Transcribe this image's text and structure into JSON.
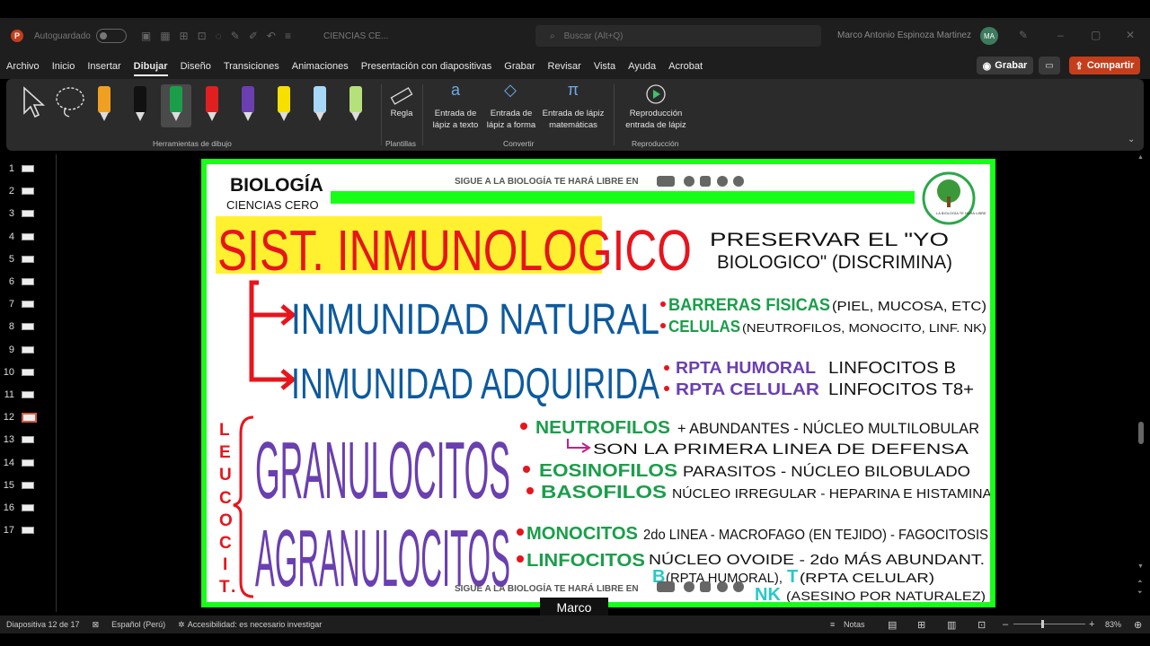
{
  "app": {
    "autosave_label": "Autoguardado",
    "document_title": "CIENCIAS CE...",
    "search_placeholder": "Buscar (Alt+Q)",
    "user_name": "Marco Antonio Espinoza Martinez",
    "user_initials": "MA"
  },
  "menu": {
    "items": [
      "Archivo",
      "Inicio",
      "Insertar",
      "Dibujar",
      "Diseño",
      "Transiciones",
      "Animaciones",
      "Presentación con diapositivas",
      "Grabar",
      "Revisar",
      "Vista",
      "Ayuda",
      "Acrobat"
    ],
    "active": "Dibujar",
    "record_label": "Grabar",
    "share_label": "Compartir"
  },
  "ribbon": {
    "groups": {
      "drawing_tools": "Herramientas de dibujo",
      "templates": "Plantillas",
      "convert": "Convertir",
      "replay": "Reproducción"
    },
    "ruler": "Regla",
    "ink_to_text": "Entrada de lápiz a texto",
    "ink_to_shape": "Entrada de lápiz a forma",
    "ink_to_math": "Entrada de lápiz matemáticas",
    "ink_replay": "Reproducción entrada de lápiz",
    "pen_colors": [
      "#f0a020",
      "#111111",
      "#1a9e4a",
      "#e02020",
      "#6a3fb0",
      "#f5e000",
      "#a8d8f8",
      "#b6e07a"
    ]
  },
  "thumbnails": {
    "numbers": [
      "1",
      "2",
      "3",
      "4",
      "5",
      "6",
      "7",
      "8",
      "9",
      "10",
      "11",
      "12",
      "13",
      "14",
      "15",
      "16",
      "17"
    ],
    "active": "12"
  },
  "slide": {
    "header_left_1": "BIOLOGÍA",
    "header_left_2": "CIENCIAS CERO",
    "banner_top": "SIGUE A LA BIOLOGÍA TE HARÁ LIBRE EN",
    "banner_bottom": "SIGUE A LA BIOLOGÍA TE HARÁ LIBRE EN",
    "logo_text": "LA BIOLOGÍA TE HARÁ LIBRE",
    "title": "SIST. INMUNOLOGICO",
    "subtitle_1": "PRESERVAR EL \"YO",
    "subtitle_2": "BIOLOGICO\" (DISCRIMINA)",
    "natural": "INMUNIDAD NATURAL",
    "natural_items": [
      {
        "key": "BARRERAS FISICAS",
        "val": "(PIEL, MUCOSA, ETC)"
      },
      {
        "key": "CELULAS",
        "val": "(NEUTROFILOS, MONOCITO, LINF. NK)"
      }
    ],
    "adquirida": "INMUNIDAD ADQUIRIDA",
    "adquirida_items": [
      {
        "key": "RPTA HUMORAL",
        "val": "LINFOCITOS B"
      },
      {
        "key": "RPTA CELULAR",
        "val": "LINFOCITOS T8+"
      }
    ],
    "vertical_label": [
      "L",
      "E",
      "U",
      "C",
      "O",
      "C",
      "I",
      "T",
      "."
    ],
    "granulocitos": "GRANULOCITOS",
    "gran_items": [
      {
        "key": "NEUTROFILOS",
        "val": "+ ABUNDANTES - NÚCLEO MULTILOBULAR"
      },
      {
        "key": "",
        "val": "SON LA PRIMERA LINEA DE DEFENSA"
      },
      {
        "key": "EOSINOFILOS",
        "val": "PARASITOS - NÚCLEO BILOBULADO"
      },
      {
        "key": "BASOFILOS",
        "val": "NÚCLEO IRREGULAR - HEPARINA E HISTAMINA"
      }
    ],
    "agranulocitos": "AGRANULOCITOS",
    "agran_items": [
      {
        "key": "MONOCITOS",
        "val": "2do LINEA - MACROFAGO (EN TEJIDO) - FAGOCITOSIS"
      },
      {
        "key": "LINFOCITOS",
        "val": "NÚCLEO OVOIDE - 2do MÁS ABUNDANT."
      },
      {
        "key": "B",
        "val": "(RPTA HUMORAL),",
        "key2": "T",
        "val2": "(RPTA CELULAR)"
      },
      {
        "key": "NK",
        "val": "(ASESINO POR NATURALEZ)"
      }
    ]
  },
  "caption": "Marco",
  "status": {
    "slide_info": "Diapositiva 12 de 17",
    "language": "Español (Perú)",
    "accessibility": "Accesibilidad: es necesario investigar",
    "notes": "Notas",
    "zoom": "83%"
  }
}
